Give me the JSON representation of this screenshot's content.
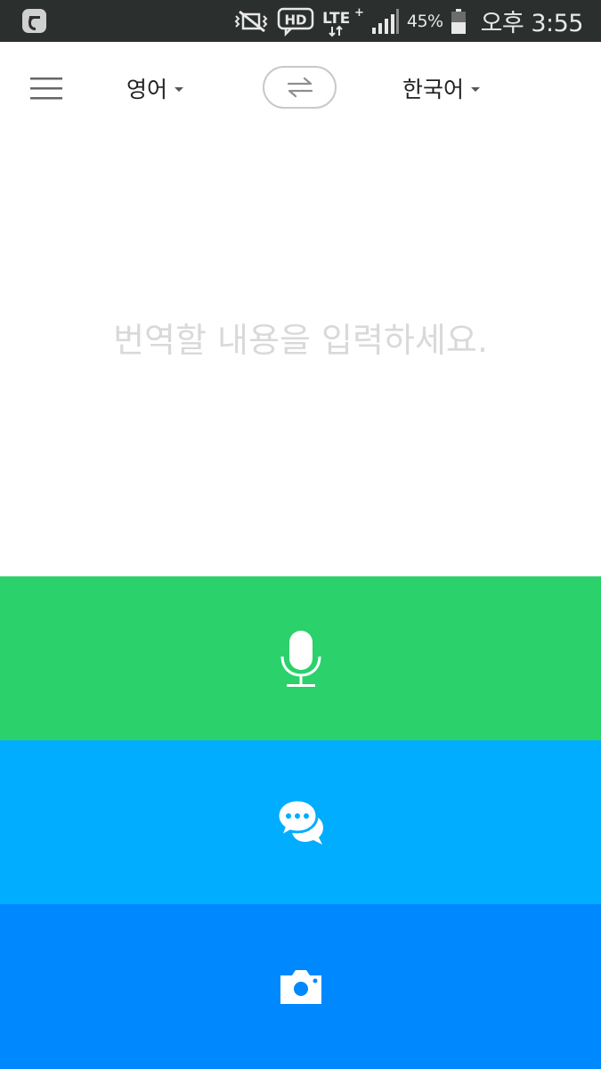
{
  "status_bar": {
    "battery_percent": "45%",
    "time": "오후 3:55",
    "network": "LTE+",
    "icons": [
      "app-icon",
      "vibrate-icon",
      "hd-icon",
      "lte-icon",
      "signal-icon",
      "battery-icon"
    ]
  },
  "toolbar": {
    "menu_icon": "hamburger-menu-icon",
    "source_language": "영어",
    "target_language": "한국어",
    "swap_icon": "swap-arrows-icon"
  },
  "input": {
    "placeholder": "번역할 내용을 입력하세요."
  },
  "actions": [
    {
      "name": "voice",
      "icon": "microphone-icon",
      "color": "#2bd16b"
    },
    {
      "name": "conversation",
      "icon": "chat-bubbles-icon",
      "color": "#00adff"
    },
    {
      "name": "camera",
      "icon": "camera-icon",
      "color": "#0088ff"
    }
  ],
  "colors": {
    "status_bar": "#2b2f2e",
    "placeholder": "#d9d9d9",
    "voice": "#2bd16b",
    "conversation": "#00adff",
    "camera": "#0088ff"
  }
}
